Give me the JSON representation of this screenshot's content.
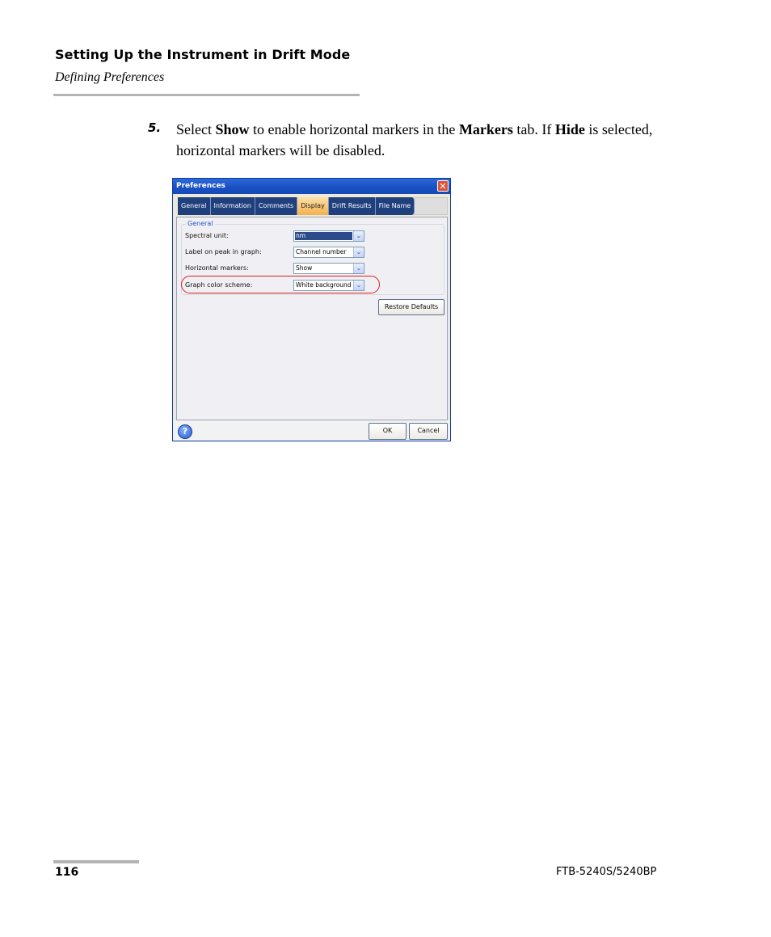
{
  "header": {
    "title": "Setting Up the Instrument in Drift Mode",
    "subtitle": "Defining Preferences"
  },
  "step": {
    "number": "5.",
    "t1": "Select ",
    "b1": "Show",
    "t2": " to enable horizontal markers in the ",
    "b2": "Markers",
    "t3": " tab. If ",
    "b3": "Hide",
    "t4": " is selected, horizontal markers will be disabled."
  },
  "dialog": {
    "title": "Preferences",
    "close_glyph": "✕",
    "tabs": [
      "General",
      "Information",
      "Comments",
      "Display",
      "Drift Results",
      "File Name"
    ],
    "active_tab": "Display",
    "group_label": "General",
    "rows": [
      {
        "label": "Spectral unit:",
        "value": "nm"
      },
      {
        "label": "Label on peak in graph:",
        "value": "Channel number"
      },
      {
        "label": "Horizontal markers:",
        "value": "Show"
      },
      {
        "label": "Graph color scheme:",
        "value": "White background"
      }
    ],
    "dropdown_glyph": "⌄",
    "restore_defaults_label": "Restore Defaults",
    "help_glyph": "?",
    "ok_label": "OK",
    "cancel_label": "Cancel"
  },
  "colors": {
    "titlebar": "#1a50c4",
    "tab_bg": "#1f3f7d",
    "tab_active": "#f3b14e",
    "highlight_ring": "#d82020"
  },
  "footer": {
    "page_number": "116",
    "model": "FTB-5240S/5240BP"
  }
}
